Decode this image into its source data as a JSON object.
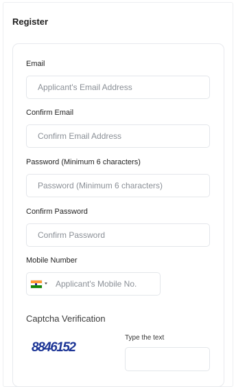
{
  "page": {
    "title": "Register"
  },
  "form": {
    "email": {
      "label": "Email",
      "placeholder": "Applicant's Email Address",
      "value": ""
    },
    "confirm_email": {
      "label": "Confirm Email",
      "placeholder": "Confirm Email Address",
      "value": ""
    },
    "password": {
      "label": "Password (Minimum 6 characters)",
      "placeholder": "Password (Minimum 6 characters)",
      "value": ""
    },
    "confirm_password": {
      "label": "Confirm Password",
      "placeholder": "Confirm Password",
      "value": ""
    },
    "mobile": {
      "label": "Mobile Number",
      "placeholder": "Applicant's Mobile No.",
      "value": "",
      "country_flag": "india-flag-icon"
    },
    "captcha": {
      "heading": "Captcha Verification",
      "code": "8846152",
      "input_label": "Type the text",
      "value": ""
    }
  },
  "colors": {
    "captcha_text": "#1c3596",
    "border": "#e3e6ea",
    "placeholder": "#8a8f96"
  }
}
